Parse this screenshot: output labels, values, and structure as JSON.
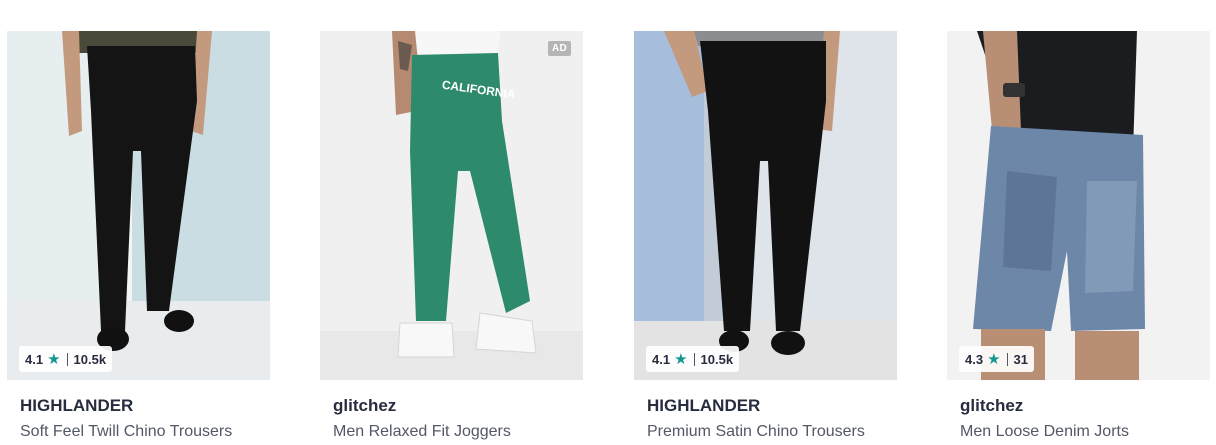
{
  "products": [
    {
      "brand": "HIGHLANDER",
      "name": "Soft Feel Twill Chino Trousers",
      "rating": "4.1",
      "count": "10.5k",
      "ad": ""
    },
    {
      "brand": "glitchez",
      "name": "Men Relaxed Fit Joggers",
      "rating": "",
      "count": "",
      "ad": "AD",
      "print_text": "CALIFORNIA"
    },
    {
      "brand": "HIGHLANDER",
      "name": "Premium Satin Chino Trousers",
      "rating": "4.1",
      "count": "10.5k",
      "ad": ""
    },
    {
      "brand": "glitchez",
      "name": "Men Loose Denim Jorts",
      "rating": "4.3",
      "count": "31",
      "ad": ""
    }
  ],
  "colors": {
    "rating_star": "#14958f",
    "brand_text": "#282c3f",
    "name_text": "#535766"
  },
  "icons": {
    "rating": "star-icon"
  }
}
